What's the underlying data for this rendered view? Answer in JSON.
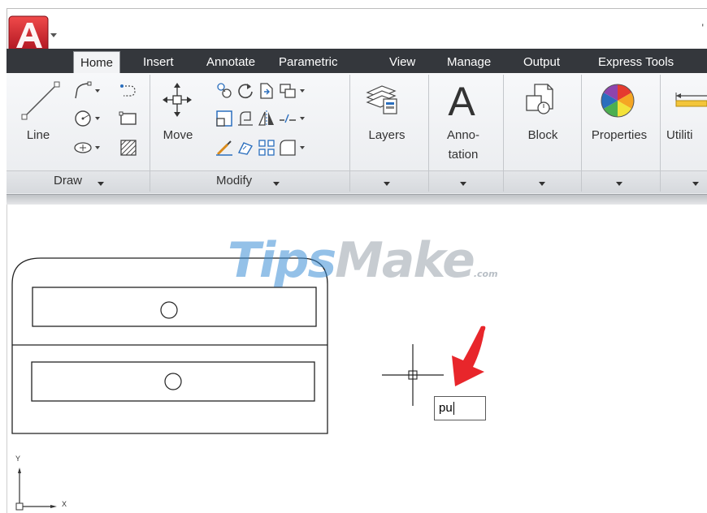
{
  "app": {
    "logo_letter": "A"
  },
  "tabs": [
    {
      "label": "Home",
      "active": true
    },
    {
      "label": "Insert",
      "active": false
    },
    {
      "label": "Annotate",
      "active": false
    },
    {
      "label": "Parametric",
      "active": false
    },
    {
      "label": "View",
      "active": false
    },
    {
      "label": "Manage",
      "active": false
    },
    {
      "label": "Output",
      "active": false
    },
    {
      "label": "Express Tools",
      "active": false
    }
  ],
  "ribbon": {
    "draw": {
      "line_label": "Line",
      "panel_label": "Draw"
    },
    "modify": {
      "move_label": "Move",
      "panel_label": "Modify"
    },
    "layers": {
      "label": "Layers"
    },
    "annotation": {
      "label_line1": "Anno-",
      "label_line2": "tation"
    },
    "block": {
      "label": "Block"
    },
    "properties": {
      "label": "Properties"
    },
    "utilities": {
      "label": "Utiliti"
    }
  },
  "canvas": {
    "watermark_tips": "Tips",
    "watermark_make": "Make",
    "watermark_com": ".com",
    "command_input_value": "pu",
    "ucs_y": "Y",
    "ucs_x": "X"
  },
  "colors": {
    "tabbar_bg": "#34373c",
    "logo_red": "#c8102e",
    "arrow_red": "#e8262b",
    "watermark_blue": "#3d8fd6"
  },
  "icons": [
    "application-menu-icon",
    "line-icon",
    "polyline-icon",
    "arc-icon",
    "circle-icon",
    "rectangle-icon",
    "ellipse-icon",
    "hatch-icon",
    "move-icon",
    "rotate-icon",
    "trim-icon",
    "copy-icon",
    "mirror-icon",
    "fillet-icon",
    "stretch-icon",
    "scale-icon",
    "array-icon",
    "offset-icon",
    "layers-icon",
    "annotation-icon",
    "block-icon",
    "properties-icon",
    "utilities-icon",
    "crosshair-cursor",
    "red-arrow-icon"
  ]
}
